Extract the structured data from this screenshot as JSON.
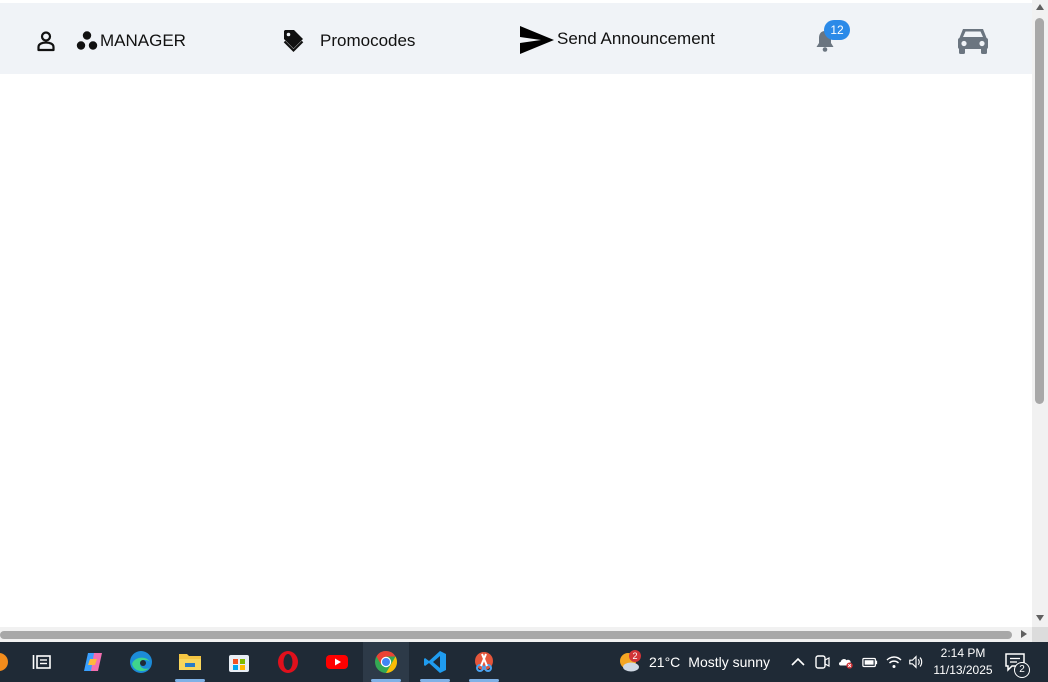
{
  "nav": {
    "manager_label": "MANAGER",
    "promocodes_label": "Promocodes",
    "announce_label": "Send Announcement",
    "notifications_count": "12",
    "icons": {
      "user": "person-icon",
      "manager": "group-dots-icon",
      "promocodes": "tag-icon",
      "announce": "send-icon",
      "notifications": "bell-icon",
      "vehicle": "car-icon"
    }
  },
  "taskbar": {
    "apps": [
      "partial-orange-icon",
      "task-view-icon",
      "copilot-icon",
      "edge-icon",
      "file-explorer-icon",
      "microsoft-store-icon",
      "opera-icon",
      "youtube-icon",
      "chrome-icon",
      "vscode-icon",
      "snipping-tool-icon"
    ],
    "weather": {
      "temperature": "21°C",
      "condition": "Mostly sunny",
      "badge": "2"
    },
    "clock": {
      "time": "2:14 PM",
      "date": "11/13/2025"
    },
    "notification_count": "2"
  },
  "colors": {
    "topbar_bg": "#f0f3f7",
    "badge_blue": "#2b8ae8",
    "taskbar_bg": "#1f2a36"
  }
}
